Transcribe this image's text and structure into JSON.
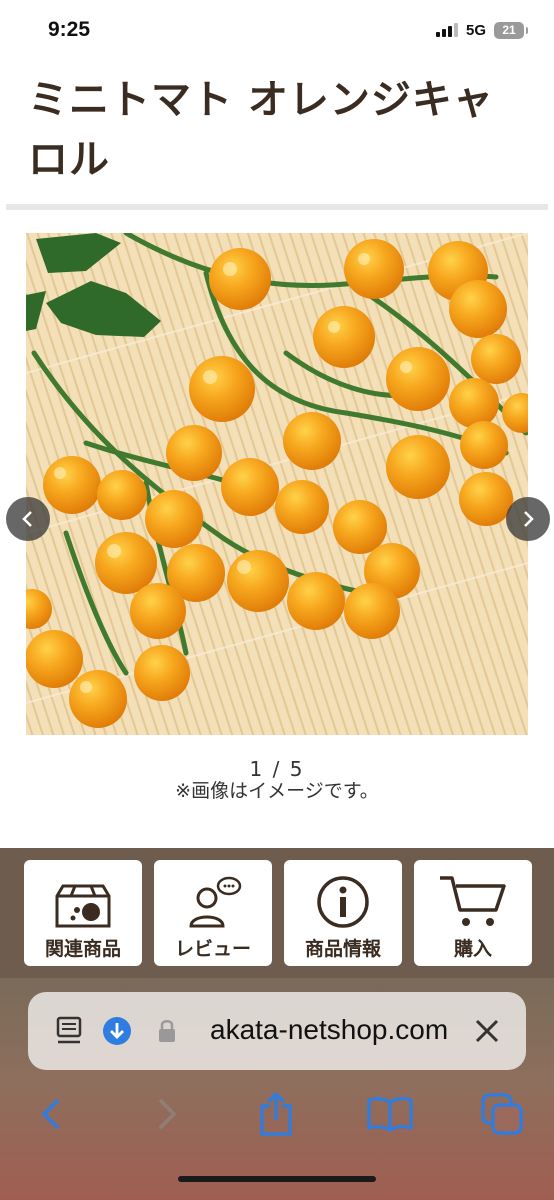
{
  "status_bar": {
    "time": "9:25",
    "network": "5G",
    "battery": "21"
  },
  "product": {
    "title": "ミニトマト オレンジキャロル",
    "image_icon": "cherry-tomato-photo",
    "pager": "1 / 5",
    "caption": "※画像はイメージです。"
  },
  "menu": {
    "items": [
      {
        "label": "関連商品",
        "icon": "box-icon"
      },
      {
        "label": "レビュー",
        "icon": "review-person-icon"
      },
      {
        "label": "商品情報",
        "icon": "info-icon"
      },
      {
        "label": "購入",
        "icon": "cart-icon"
      }
    ]
  },
  "browser": {
    "url": "akata-netshop.com",
    "accent": "#2f7de1"
  },
  "colors": {
    "title": "#3b2c22",
    "menu_bg": "#6e5d4e",
    "tomato": "#f5a21a"
  }
}
